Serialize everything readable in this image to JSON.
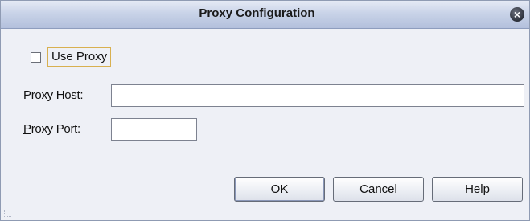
{
  "window": {
    "title": "Proxy Configuration",
    "close_symbol": "×"
  },
  "use_proxy": {
    "label": "Use Proxy",
    "checked": false
  },
  "proxy_host": {
    "label_prefix": "P",
    "label_mnemonic": "r",
    "label_rest": "oxy Host:",
    "value": ""
  },
  "proxy_port": {
    "label_mnemonic": "P",
    "label_rest": "roxy Port:",
    "value": ""
  },
  "buttons": {
    "ok": "OK",
    "cancel": "Cancel",
    "help_mnemonic": "H",
    "help_rest": "elp"
  },
  "icons": {
    "close": "close-icon",
    "checkbox": "checkbox-icon",
    "resize_grip": "resize-grip-icon"
  },
  "colors": {
    "titlebar": "#c9d3e8",
    "dialog_bg": "#eef0f6",
    "focus_border": "#d8b050"
  }
}
